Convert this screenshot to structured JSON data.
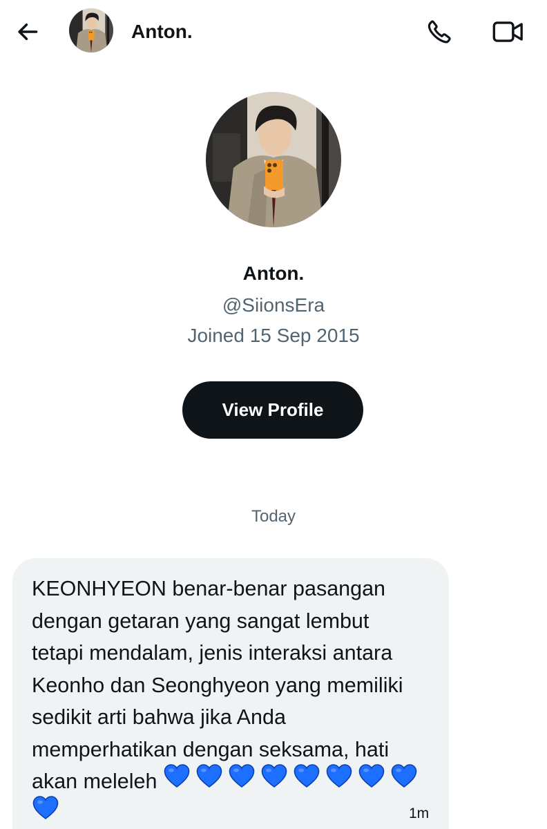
{
  "header": {
    "title": "Anton.",
    "back_icon": "arrow-left-icon",
    "call_icon": "phone-icon",
    "video_icon": "video-camera-icon"
  },
  "profile": {
    "name": "Anton.",
    "handle": "@SiionsEra",
    "joined": "Joined 15 Sep 2015",
    "view_profile_label": "View Profile"
  },
  "conversation": {
    "day_divider": "Today",
    "messages": [
      {
        "text": "KEONHYEON benar-benar pasangan\ndengan getaran yang sangat lembut\ntetapi mendalam, jenis interaksi antara\nKeonho dan Seonghyeon yang memiliki\nsedikit arti bahwa jika Anda\nmemperhatikan dengan seksama, hati\nakan meleleh",
        "emoji": "💙💙💙💙💙💙💙💙💙",
        "emoji_count": 9,
        "time": "1m"
      }
    ]
  },
  "colors": {
    "text_primary": "#0f1419",
    "text_secondary": "#536471",
    "bubble_background": "#eff3f4",
    "button_background": "#0f1419",
    "heart_blue": "#1d6fff"
  }
}
